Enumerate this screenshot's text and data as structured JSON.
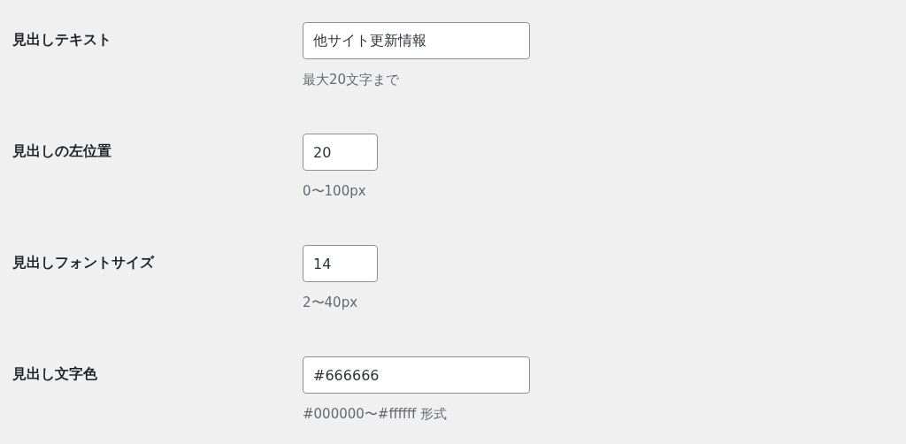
{
  "settings": [
    {
      "label": "見出しテキスト",
      "kind": "text",
      "value": "他サイト更新情報",
      "hint": "最大20文字まで"
    },
    {
      "label": "見出しの左位置",
      "kind": "number",
      "value": "20",
      "hint": "0〜100px"
    },
    {
      "label": "見出しフォントサイズ",
      "kind": "number",
      "value": "14",
      "hint": "2〜40px"
    },
    {
      "label": "見出し文字色",
      "kind": "text",
      "value": "#666666",
      "hint": "#000000〜#ffffff 形式"
    }
  ]
}
